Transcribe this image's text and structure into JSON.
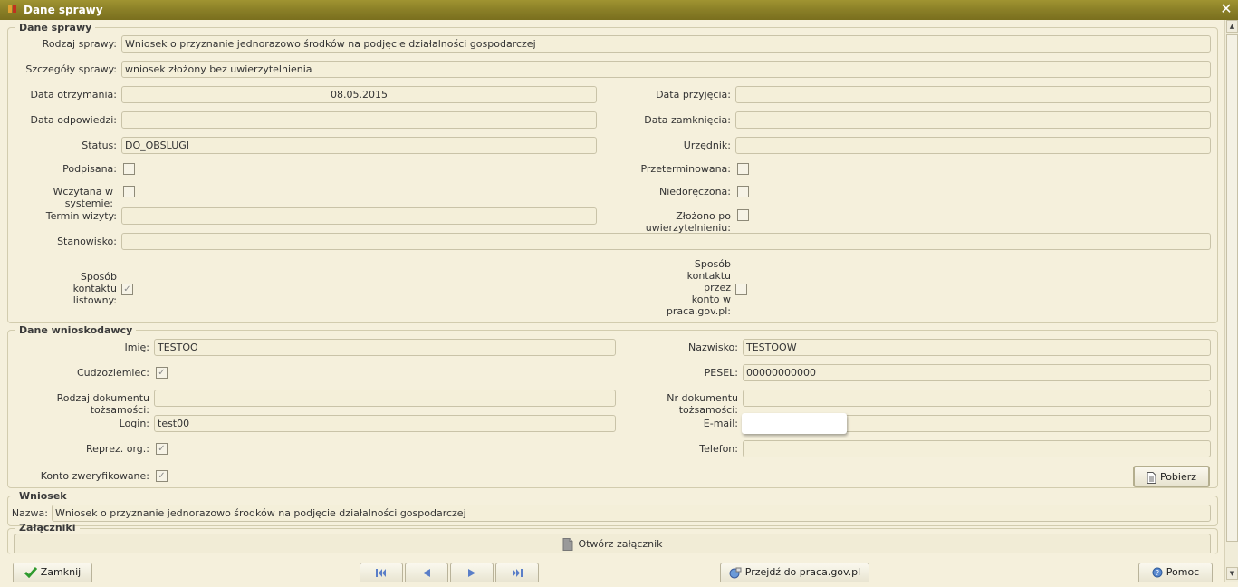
{
  "window": {
    "title": "Dane sprawy"
  },
  "dane_sprawy": {
    "legend": "Dane sprawy",
    "rodzaj_sprawy": {
      "label": "Rodzaj sprawy:",
      "value": "Wniosek o przyznanie jednorazowo środków na podjęcie działalności gospodarczej"
    },
    "szczegoly_sprawy": {
      "label": "Szczegóły sprawy:",
      "value": "wniosek złożony bez uwierzytelnienia"
    },
    "data_otrzymania": {
      "label": "Data otrzymania:",
      "value": "08.05.2015"
    },
    "data_przyjecia": {
      "label": "Data przyjęcia:",
      "value": ""
    },
    "data_odpowiedzi": {
      "label": "Data odpowiedzi:",
      "value": ""
    },
    "data_zamkniecia": {
      "label": "Data zamknięcia:",
      "value": ""
    },
    "status": {
      "label": "Status:",
      "value": "DO_OBSLUGI"
    },
    "urzednik": {
      "label": "Urzędnik:",
      "value": ""
    },
    "podpisana": {
      "label": "Podpisana:",
      "checked": false
    },
    "przeterminowana": {
      "label": "Przeterminowana:",
      "checked": false
    },
    "wczytana": {
      "label": "Wczytana w systemie:",
      "checked": false
    },
    "niedoreczona": {
      "label": "Niedoręczona:",
      "checked": false
    },
    "termin_wizyty": {
      "label": "Termin wizyty:",
      "value": ""
    },
    "zlozono_po": {
      "label": "Złożono po uwierzytelnieniu:",
      "checked": false
    },
    "stanowisko": {
      "label": "Stanowisko:",
      "value": ""
    },
    "kontakt_listowny": {
      "label_lines": [
        "Sposób",
        "kontaktu",
        "listowny:"
      ],
      "checked": true
    },
    "kontakt_konto": {
      "label_lines": [
        "Sposób",
        "kontaktu",
        "przez",
        "konto w",
        "praca.gov.pl:"
      ],
      "checked": false
    }
  },
  "dane_wnioskodawcy": {
    "legend": "Dane wnioskodawcy",
    "imie": {
      "label": "Imię:",
      "value": "TESTOO"
    },
    "nazwisko": {
      "label": "Nazwisko:",
      "value": "TESTOOW"
    },
    "cudzoziemiec": {
      "label": "Cudzoziemiec:",
      "checked": true
    },
    "pesel": {
      "label": "PESEL:",
      "value": "00000000000"
    },
    "rodzaj_dok": {
      "label": "Rodzaj dokumentu tożsamości:",
      "value": ""
    },
    "nr_dok": {
      "label": "Nr dokumentu tożsamości:",
      "value": ""
    },
    "login": {
      "label": "Login:",
      "value": "test00"
    },
    "email": {
      "label": "E-mail:",
      "value": ""
    },
    "reprez": {
      "label": "Reprez. org.:",
      "checked": true
    },
    "telefon": {
      "label": "Telefon:",
      "value": ""
    },
    "konto_zweryfikowane": {
      "label": "Konto zweryfikowane:",
      "checked": true
    },
    "pobierz_label": "Pobierz"
  },
  "wniosek": {
    "legend": "Wniosek",
    "nazwa": {
      "label": "Nazwa:",
      "value": "Wniosek o przyznanie jednorazowo środków na podjęcie działalności gospodarczej"
    }
  },
  "zalaczniki": {
    "legend": "Załączniki",
    "otworz_label": "Otwórz załącznik"
  },
  "footer": {
    "zamknij_label": "Zamknij",
    "przejdz_label": "Przejdź do praca.gov.pl",
    "pomoc_label": "Pomoc"
  },
  "colors": {
    "accent": "#8c8128",
    "background": "#f5f0dc",
    "field": "#f4efd9",
    "check_green": "#2e9a2e"
  }
}
